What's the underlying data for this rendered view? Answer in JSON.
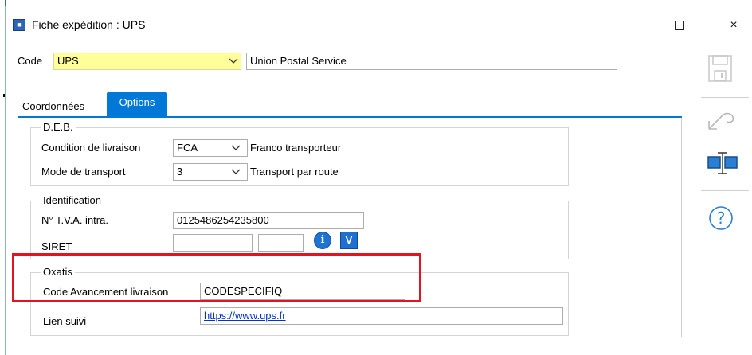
{
  "window": {
    "title": "Fiche expédition : UPS",
    "app_icon_glyph": "■",
    "controls": {
      "minimize": "minimize",
      "maximize": "maximize",
      "close": "×"
    }
  },
  "code": {
    "label": "Code",
    "value": "UPS",
    "description": "Union Postal Service"
  },
  "tabs": [
    {
      "label": "Coordonnées",
      "active": false
    },
    {
      "label": "Options",
      "active": true
    }
  ],
  "deb": {
    "title": "D.E.B.",
    "condition_label": "Condition de livraison",
    "condition_value": "FCA",
    "condition_desc": "Franco transporteur",
    "transport_label": "Mode de transport",
    "transport_value": "3",
    "transport_desc": "Transport par route"
  },
  "identification": {
    "title": "Identification",
    "tva_label": "N° T.V.A. intra.",
    "tva_value": "0125486254235800",
    "siret_label": "SIRET",
    "siret_value_1": "",
    "siret_value_2": "",
    "info_button": "i",
    "v_button": "V"
  },
  "oxatis": {
    "title": "Oxatis",
    "code_avancement_label": "Code Avancement livraison",
    "code_avancement_value": "CODESPECIFIQ"
  },
  "lien_suivi": {
    "label": "Lien suivi",
    "value": "https://www.ups.fr"
  },
  "side_toolbar": {
    "icons": [
      "save-icon",
      "undo-icon",
      "field-text-icon",
      "help-icon"
    ],
    "help_glyph": "?"
  },
  "colors": {
    "accent": "#0078d7",
    "highlight": "#e2141f",
    "code_field_bg": "#ffff99",
    "link": "#0033cc"
  }
}
